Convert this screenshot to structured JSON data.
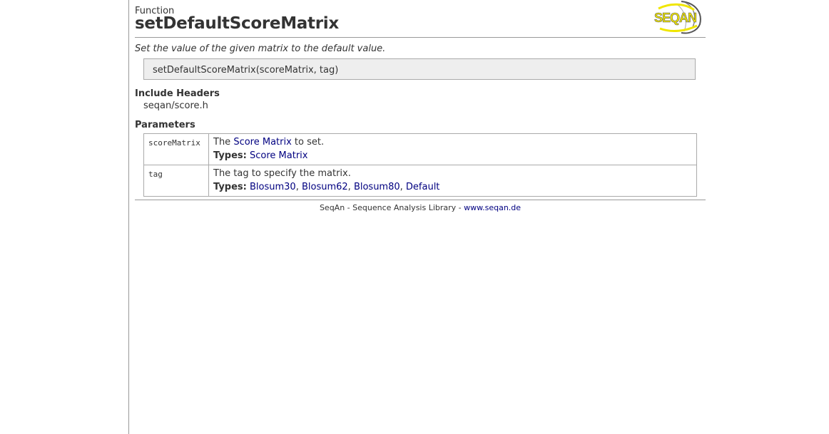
{
  "header": {
    "kind": "Function",
    "title": "setDefaultScoreMatrix",
    "logo_text": "SEQAN"
  },
  "summary": "Set the value of the given matrix to the default value.",
  "signature": "setDefaultScoreMatrix(scoreMatrix, tag)",
  "include": {
    "heading": "Include Headers",
    "value": "seqan/score.h"
  },
  "parameters": {
    "heading": "Parameters",
    "types_label": "Types:",
    "rows": [
      {
        "name": "scoreMatrix",
        "desc_prefix": "The ",
        "desc_link": "Score Matrix",
        "desc_suffix": " to set.",
        "types": [
          "Score Matrix"
        ]
      },
      {
        "name": "tag",
        "desc": "The tag to specify the matrix.",
        "types": [
          "Blosum30",
          "Blosum62",
          "Blosum80",
          "Default"
        ],
        "sep": ", "
      }
    ]
  },
  "footer": {
    "text": "SeqAn - Sequence Analysis Library - ",
    "link": "www.seqan.de"
  },
  "colors": {
    "link": "#000080",
    "signature_bg": "#eeeeee",
    "logo_yellow": "#f0e600"
  }
}
